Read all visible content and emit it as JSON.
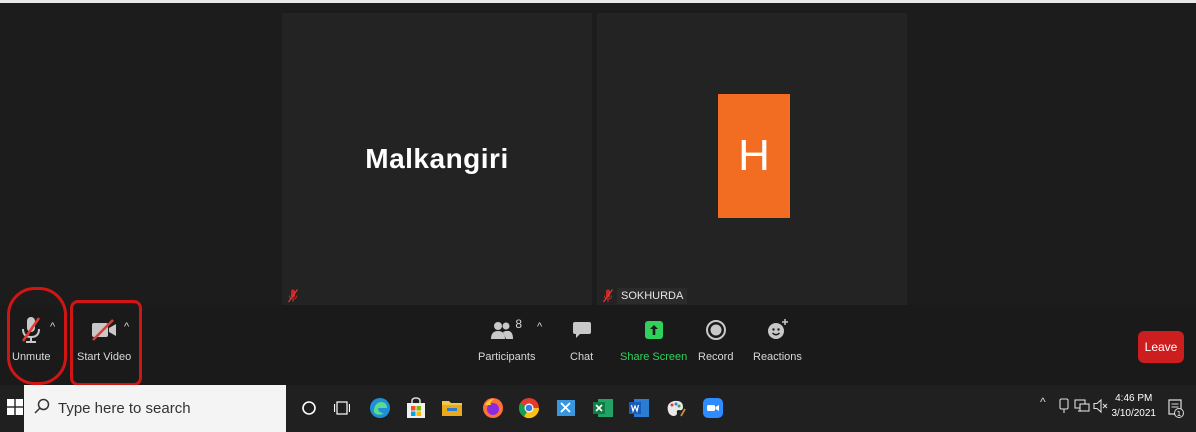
{
  "tiles": {
    "participant1": {
      "name": "Malkangiri"
    },
    "participant2": {
      "initial": "H",
      "name": "SOKHURDA",
      "avatar_color": "#f26d21"
    }
  },
  "toolbar": {
    "unmute": {
      "label": "Unmute"
    },
    "start_video": {
      "label": "Start Video"
    },
    "participants": {
      "label": "Participants",
      "count": "8"
    },
    "chat": {
      "label": "Chat"
    },
    "share_screen": {
      "label": "Share Screen",
      "color": "#2fd15b"
    },
    "record": {
      "label": "Record"
    },
    "reactions": {
      "label": "Reactions"
    },
    "leave": {
      "label": "Leave",
      "color": "#cc1e1e"
    },
    "caret": "^"
  },
  "taskbar": {
    "search_placeholder": "Type here to search",
    "time": "4:46 PM",
    "date": "3/10/2021",
    "tray_caret": "^",
    "notifications_count": "1",
    "pinned": [
      "cortana-icon",
      "task-view-icon",
      "edge-icon",
      "store-icon",
      "file-explorer-icon",
      "firefox-icon",
      "chrome-icon",
      "snipping-icon",
      "excel-icon",
      "word-icon",
      "paint-icon",
      "zoom-icon"
    ]
  },
  "highlight_color": "#d01515"
}
